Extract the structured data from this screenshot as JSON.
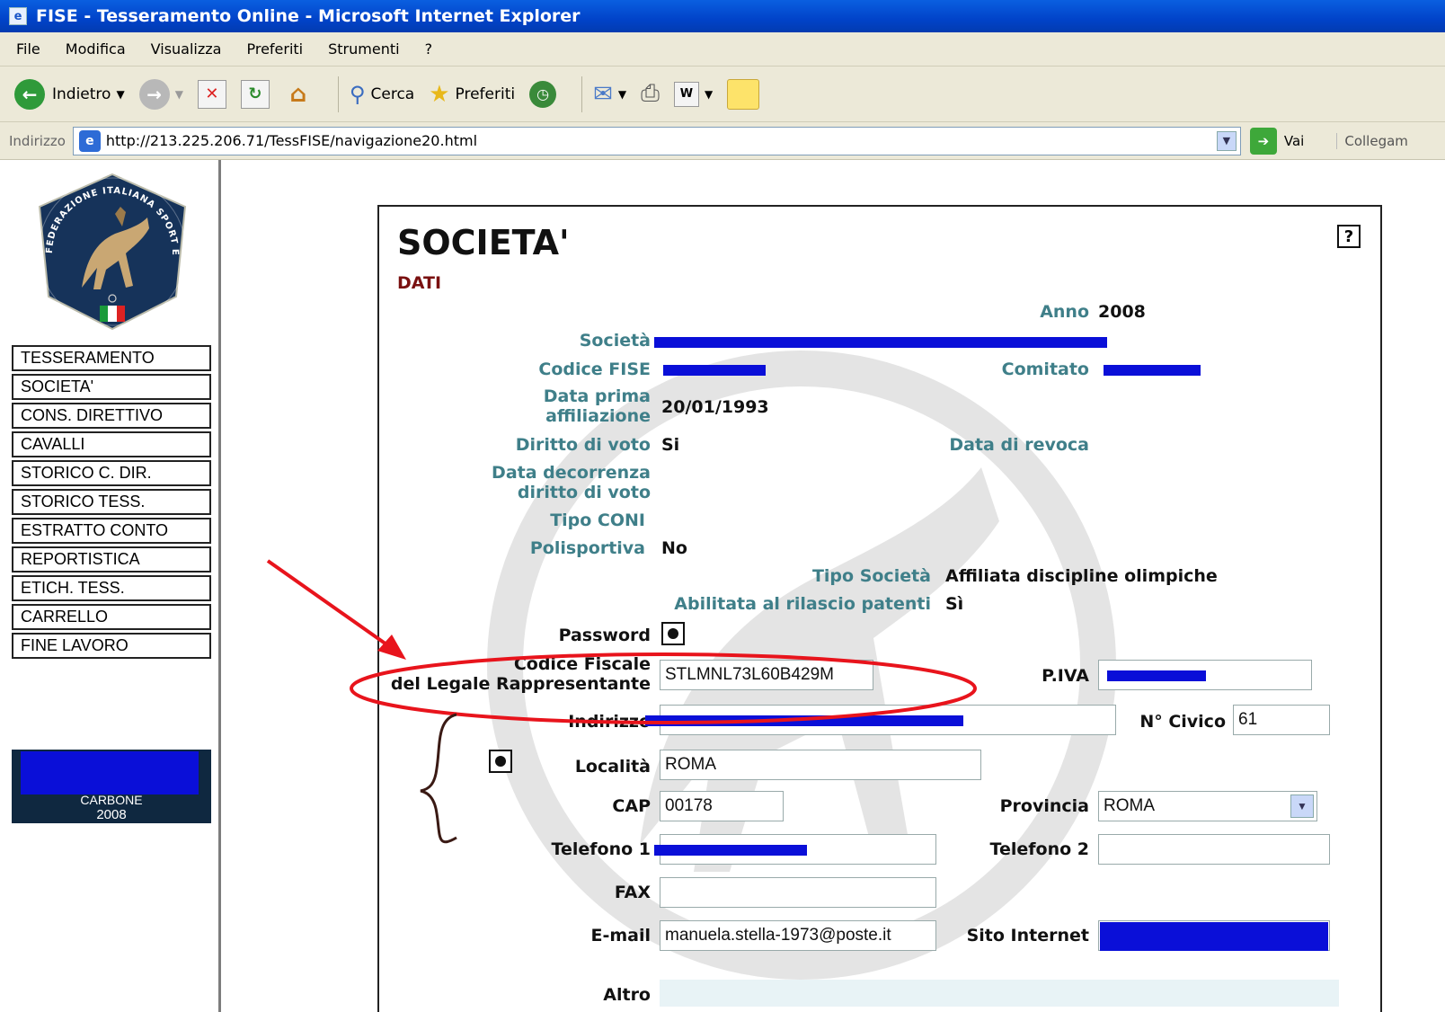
{
  "window": {
    "title": "FISE - Tesseramento Online - Microsoft Internet Explorer"
  },
  "menu": [
    "File",
    "Modifica",
    "Visualizza",
    "Preferiti",
    "Strumenti",
    "?"
  ],
  "toolbar": {
    "back_label": "Indietro",
    "search_label": "Cerca",
    "favorites_label": "Preferiti"
  },
  "address": {
    "label": "Indirizzo",
    "url": "http://213.225.206.71/TessFISE/navigazione20.html",
    "go_label": "Vai",
    "links_label": "Collegam"
  },
  "logo": {
    "text": "FEDERAZIONE ITALIANA SPORT EQUESTRI"
  },
  "nav": {
    "items": [
      "TESSERAMENTO",
      "SOCIETA'",
      "CONS. DIRETTIVO",
      "CAVALLI",
      "STORICO C. DIR.",
      "STORICO TESS.",
      "ESTRATTO CONTO",
      "REPORTISTICA",
      "ETICH. TESS.",
      "CARRELLO",
      "FINE LAVORO"
    ]
  },
  "banner": {
    "name": "CARBONE",
    "year": "2008"
  },
  "panel": {
    "title": "SOCIETA'",
    "subtitle": "DATI",
    "help": "?",
    "anno_label": "Anno",
    "anno_value": "2008",
    "societa_label": "Società",
    "codice_fise_label": "Codice FISE",
    "comitato_label": "Comitato",
    "data_prima_label_1": "Data prima",
    "data_prima_label_2": "affiliazione",
    "data_prima_value": "20/01/1993",
    "diritto_voto_label": "Diritto di voto",
    "diritto_voto_value": "Si",
    "data_revoca_label": "Data di revoca",
    "data_decorrenza_label_1": "Data decorrenza",
    "data_decorrenza_label_2": "diritto di voto",
    "tipo_coni_label": "Tipo CONI",
    "polisportiva_label": "Polisportiva",
    "polisportiva_value": "No",
    "tipo_societa_label": "Tipo Società",
    "tipo_societa_value": "Affiliata discipline olimpiche",
    "abilitata_label": "Abilitata al rilascio patenti",
    "abilitata_value": "Sì",
    "password_label": "Password",
    "cf_label_1": "Codice Fiscale",
    "cf_label_2": "del Legale Rappresentante",
    "cf_value": "STLMNL73L60B429M",
    "piva_label": "P.IVA",
    "indirizzo_label": "Indirizzo",
    "civico_label": "N° Civico",
    "civico_value": "61",
    "localita_label": "Località",
    "localita_value": "ROMA",
    "cap_label": "CAP",
    "cap_value": "00178",
    "provincia_label": "Provincia",
    "provincia_value": "ROMA",
    "tel1_label": "Telefono 1",
    "tel2_label": "Telefono 2",
    "tel2_value": "",
    "fax_label": "FAX",
    "fax_value": "",
    "email_label": "E-mail",
    "email_value": "manuela.stella-1973@poste.it",
    "sito_label": "Sito Internet",
    "altro_label": "Altro"
  },
  "colors": {
    "label_teal": "#3f7f89",
    "subtitle_red": "#7a1010",
    "redaction_blue": "#0a0fd8",
    "annotation_red": "#e8141c"
  }
}
